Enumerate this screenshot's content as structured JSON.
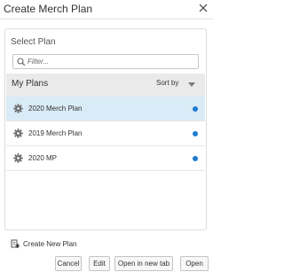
{
  "dialog": {
    "title": "Create Merch Plan",
    "close_icon": "close-icon"
  },
  "panel": {
    "title": "Select Plan",
    "filter": {
      "placeholder": "Filter...",
      "value": "",
      "icon": "search-icon"
    },
    "section_label": "My Plans",
    "sort_label": "Sort by",
    "sort_icon": "caret-down-icon",
    "plans": [
      {
        "label": "2020 Merch Plan",
        "selected": true,
        "icon": "gear-icon"
      },
      {
        "label": "2019 Merch Plan",
        "selected": false,
        "icon": "gear-icon"
      },
      {
        "label": "2020 MP",
        "selected": false,
        "icon": "gear-icon"
      }
    ]
  },
  "create_new": {
    "label": "Create New Plan",
    "icon": "create-plan-icon"
  },
  "footer": {
    "cancel_label": "Cancel",
    "edit_label": "Edit",
    "open_new_tab_label": "Open in new tab",
    "open_label": "Open"
  },
  "colors": {
    "selected_row": "#d9ebf6",
    "status_dot": "#1f7bd0",
    "section_bar": "#eaeaea"
  }
}
